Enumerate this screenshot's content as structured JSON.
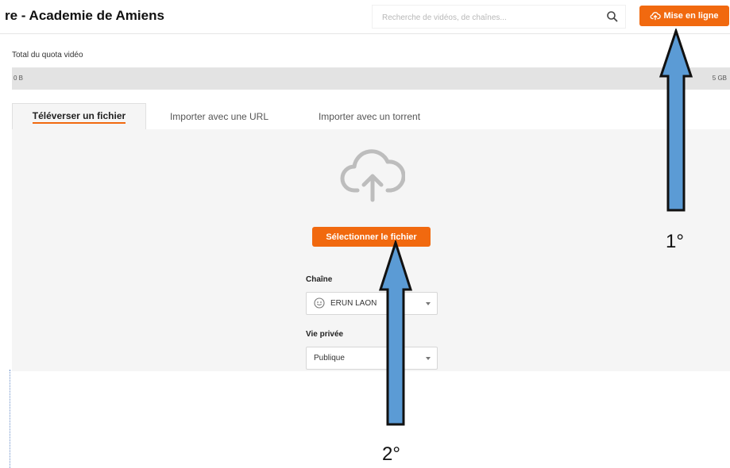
{
  "header": {
    "site_title": "re - Academie de Amiens",
    "search_placeholder": "Recherche de vidéos, de chaînes...",
    "upload_button_label": "Mise en ligne",
    "accent_color": "#f1690f"
  },
  "quota": {
    "label": "Total du quota vidéo",
    "min_label": "0 B",
    "max_label": "5 GB",
    "used_fraction": 0
  },
  "tabs": [
    {
      "label": "Téléverser un fichier",
      "active": true
    },
    {
      "label": "Importer avec une URL",
      "active": false
    },
    {
      "label": "Importer avec un torrent",
      "active": false
    }
  ],
  "upload_panel": {
    "select_file_label": "Sélectionner le fichier",
    "channel_label": "Chaîne",
    "channel_value": "ERUN LAON",
    "privacy_label": "Vie privée",
    "privacy_value": "Publique"
  },
  "annotations": {
    "step1": "1°",
    "step2": "2°",
    "arrow_color": "#5b9bd5"
  }
}
